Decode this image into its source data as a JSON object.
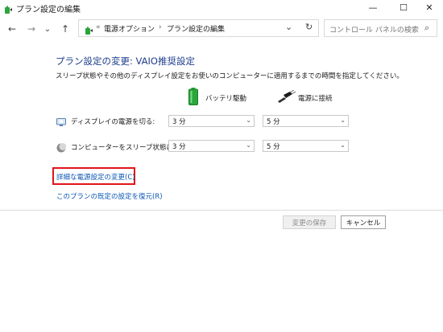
{
  "window": {
    "title": "プラン設定の編集",
    "controls": {
      "minimize": "—",
      "maximize": "☐",
      "close": "✕"
    }
  },
  "nav": {
    "back": "←",
    "forward": "→",
    "recent": "⌄",
    "up": "↑"
  },
  "address": {
    "overflow": "«",
    "crumbs": [
      "電源オプション",
      "プラン設定の編集"
    ],
    "separator": "›",
    "dropdown": "⌄",
    "refresh": "↻"
  },
  "search": {
    "placeholder": "コントロール パネルの検索",
    "icon": "⌕"
  },
  "content": {
    "heading": "プラン設定の変更: VAIO推奨設定",
    "description": "スリープ状態やその他のディスプレイ設定をお使いのコンピューターに適用するまでの時間を指定してください。",
    "columns": {
      "battery": "バッテリ駆動",
      "plugged": "電源に接続"
    },
    "rows": [
      {
        "label": "ディスプレイの電源を切る:",
        "battery": "3 分",
        "plugged": "5 分"
      },
      {
        "label": "コンピューターをスリープ状態にする:",
        "battery": "3 分",
        "plugged": "5 分"
      }
    ],
    "links": {
      "advanced": "詳細な電源設定の変更(C)",
      "restore": "このプランの既定の設定を復元(R)"
    }
  },
  "buttons": {
    "save": "変更の保存",
    "cancel": "キャンセル"
  },
  "colors": {
    "heading": "#1e3e8c",
    "link": "#0a55b4",
    "highlight": "#e1141c",
    "battery": "#2aa63a"
  }
}
